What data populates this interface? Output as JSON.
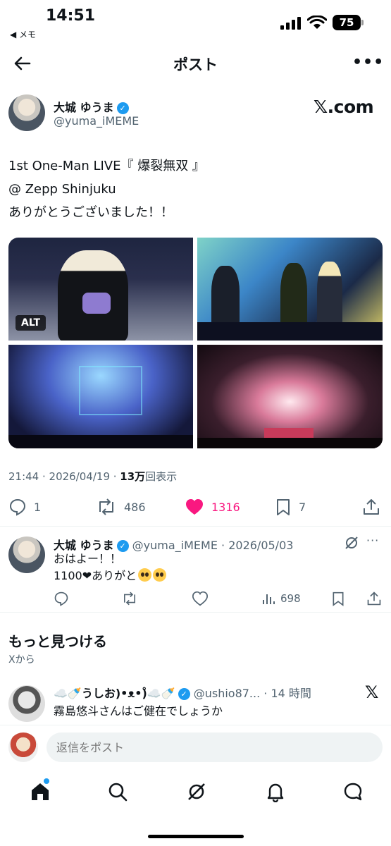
{
  "status_bar": {
    "time": "14:51",
    "back_app": "◀ メモ",
    "battery": "75"
  },
  "nav": {
    "title": "ポスト",
    "back_icon": "arrow-left-icon",
    "more_label": "•••"
  },
  "post": {
    "author_name": "大城 ゆうま",
    "author_handle": "@yuma_iMEME",
    "source": "𝕏.com",
    "text_lines": [
      "1st One-Man LIVE『 爆裂無双 』",
      "@ Zepp Shinjuku",
      "ありがとうございました！！"
    ],
    "alt_badge": "ALT",
    "meta_time": "21:44 · 2026/04/19 · ",
    "meta_views_num": "13万",
    "meta_views_label": "回表示",
    "actions": {
      "replies": "1",
      "reposts": "486",
      "likes": "1316",
      "bookmarks": "7"
    },
    "colors": {
      "like": "#f91880",
      "verified": "#1d9bf0"
    }
  },
  "reply": {
    "name": "大城 ゆうま",
    "meta": "@yuma_iMEME · 2026/05/03",
    "more_label": "···",
    "line1": "おはよー！！",
    "line2": "1100❤ありがと",
    "views": "698"
  },
  "discover": {
    "title": "もっと見つける",
    "subtitle": "Xから"
  },
  "recommended": {
    "name": "☁️🍼うしお)•ᴥ•)̊☁️🍼",
    "meta": "@ushio87... · 14 時間",
    "text": "霧島悠斗さんはご健在でしょうか",
    "x_label": "𝕏"
  },
  "composer": {
    "placeholder": "返信をポスト"
  }
}
